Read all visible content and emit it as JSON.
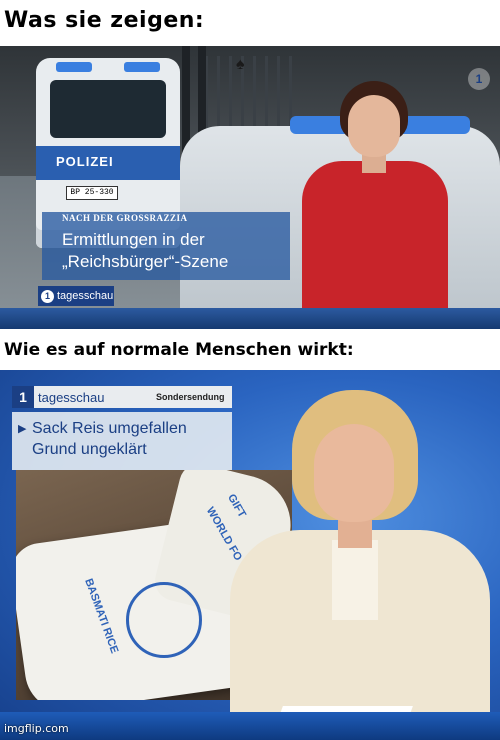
{
  "captions": {
    "top": "Was sie zeigen:",
    "middle": "Wie es auf normale Menschen wirkt:"
  },
  "panel1": {
    "van_label": "POLIZEI",
    "van_plate": "BP 25-330",
    "kicker": "NACH DER GROSSRAZZIA",
    "headline_line1": "Ermittlungen in der",
    "headline_line2": "„Reichsbürger“-Szene",
    "logo_text": "tagesschau",
    "logo_mark": "1"
  },
  "panel2": {
    "logo_mark": "1",
    "brand": "tagesschau",
    "badge": "Sondersendung",
    "headline_line1": "Sack Reis umgefallen",
    "headline_line2": "Grund ungeklärt",
    "sack_text_1": "GIFT",
    "sack_text_2": "WORLD FO",
    "sack_text_3": "BASMATI RICE"
  },
  "watermark": "imgflip.com",
  "colors": {
    "ard_blue": "#1b3f84",
    "lower_third": "#285aa0",
    "anchor1_dress": "#c8242a",
    "anchor2_blazer": "#efe6d2"
  }
}
